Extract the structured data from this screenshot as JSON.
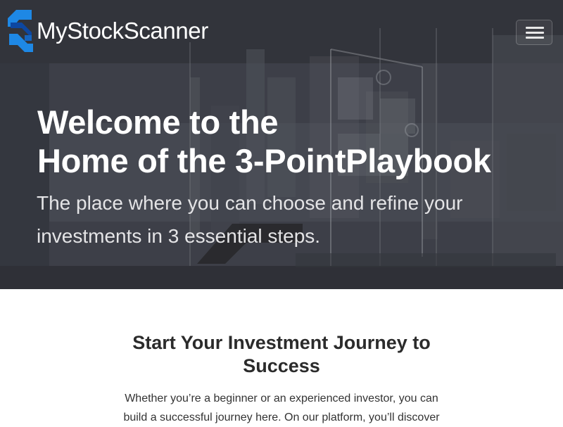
{
  "brand": {
    "name": "MyStockScanner",
    "logo_icon": "s-logo-icon",
    "logo_colors": [
      "#1e88e5",
      "#0d47a1"
    ]
  },
  "nav": {
    "menu_icon": "hamburger-menu-icon"
  },
  "hero": {
    "title_line1": "Welcome to the",
    "title_line2": "Home of the 3-PointPlaybook",
    "subtitle": "The place where you can choose and refine your investments in 3 essential steps.",
    "background": "office-city-skyline-image"
  },
  "intro": {
    "title": "Start Your Investment Journey to Success",
    "text": "Whether you’re a beginner or an experienced investor, you can build a successful journey here. On our platform, you’ll discover"
  },
  "colors": {
    "hero_text": "#ffffff",
    "subtitle_text": "#e4e4e6",
    "heading_dark": "#2b2b2b",
    "body_text": "#333333"
  }
}
